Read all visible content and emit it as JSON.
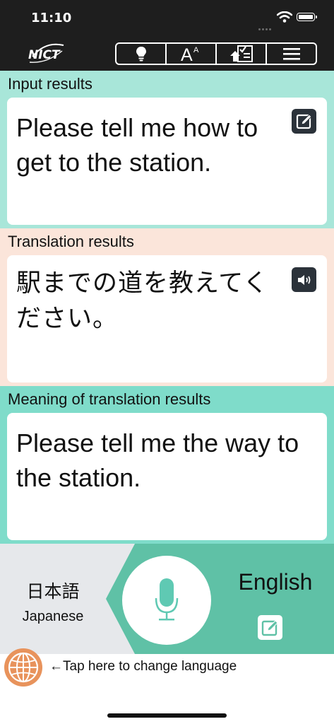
{
  "status": {
    "time": "11:10"
  },
  "header": {
    "logo_text": "NICT",
    "tools": [
      {
        "icon": "lightbulb-icon"
      },
      {
        "icon": "font-size-icon",
        "label": "A",
        "sup": "A"
      },
      {
        "icon": "upload-checklist-icon"
      },
      {
        "icon": "menu-icon"
      }
    ]
  },
  "input": {
    "label": "Input results",
    "text": "Please tell me how to get to the station."
  },
  "translation": {
    "label": "Translation results",
    "text": "駅までの道を教えてください。"
  },
  "meaning": {
    "label": "Meaning of translation results",
    "text": "Please tell me the way to the station."
  },
  "languages": {
    "source_native": "日本語",
    "source_english": "Japanese",
    "target": "English"
  },
  "footer": {
    "change_language": "←Tap here to change language"
  },
  "colors": {
    "input_bg": "#a8e6d9",
    "translation_bg": "#fbe5da",
    "meaning_bg": "#7fdcca",
    "target_lang_bg": "#5fc1a6",
    "accent": "#5fc9b3",
    "globe": "#e8935c",
    "header_bg": "#1e1e1e"
  }
}
